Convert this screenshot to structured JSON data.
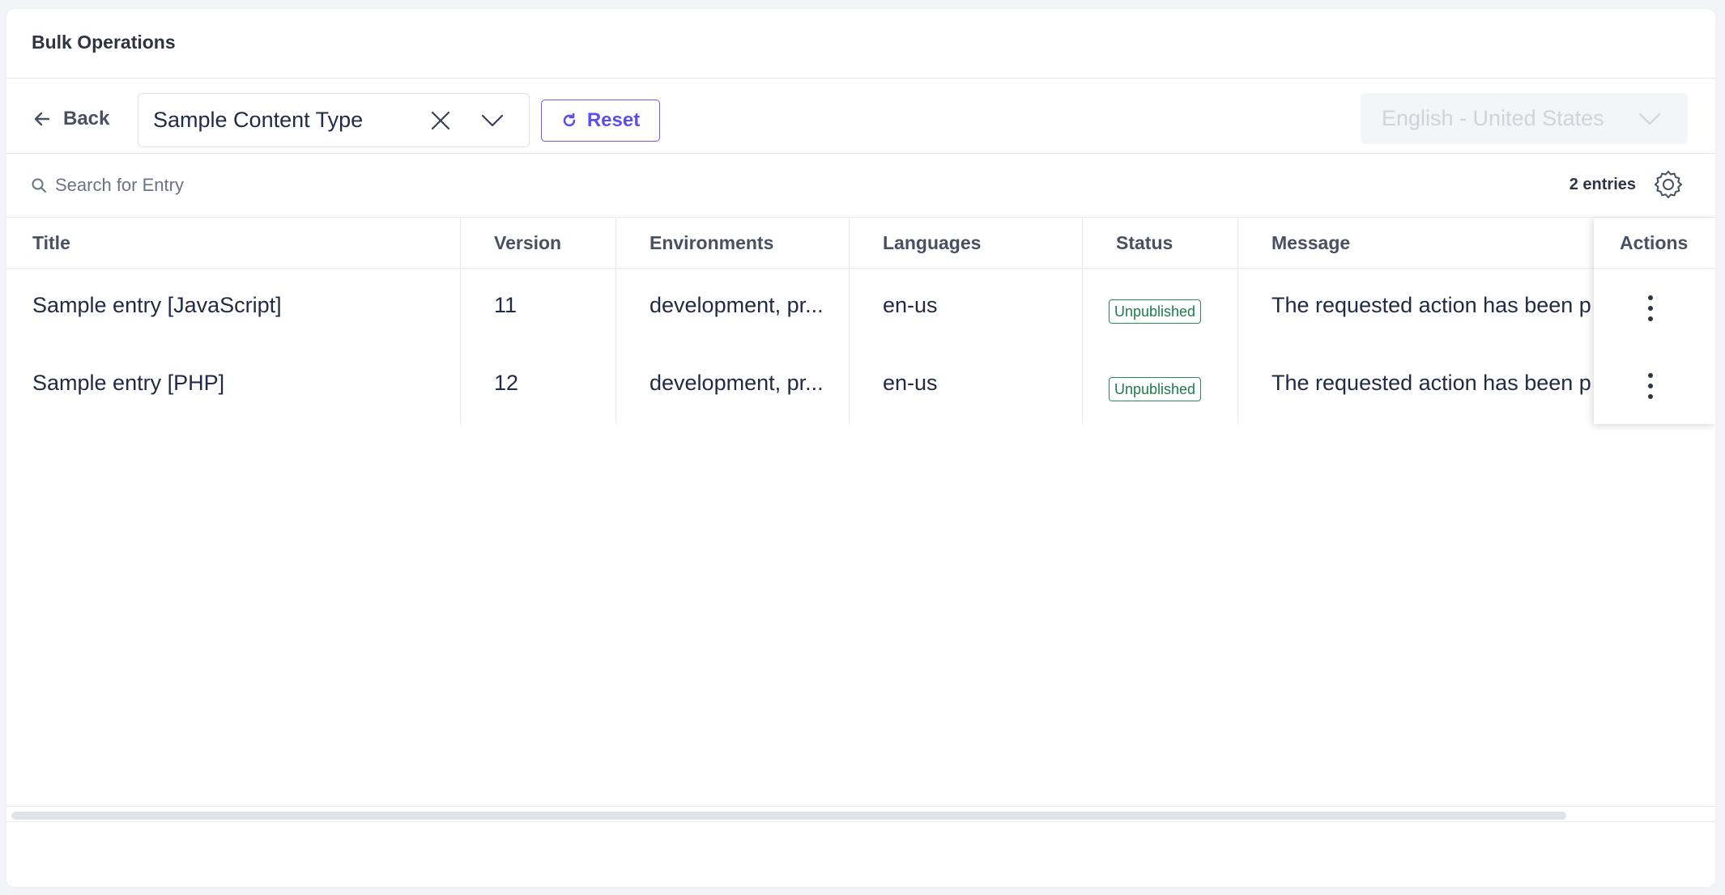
{
  "panel": {
    "title": "Bulk Operations"
  },
  "toolbar": {
    "back_label": "Back",
    "content_type": "Sample Content Type",
    "reset_label": "Reset",
    "locale": "English - United States"
  },
  "search": {
    "placeholder": "Search for Entry",
    "value": ""
  },
  "entries_count": "2 entries",
  "table": {
    "columns": [
      "Title",
      "Version",
      "Environments",
      "Languages",
      "Status",
      "Message",
      "Actions"
    ],
    "rows": [
      {
        "title": "Sample entry [JavaScript]",
        "version": "11",
        "environments": "development, pr...",
        "languages": "en-us",
        "status": "Unpublished",
        "message": "The requested action has been p"
      },
      {
        "title": "Sample entry [PHP]",
        "version": "12",
        "environments": "development, pr...",
        "languages": "en-us",
        "status": "Unpublished",
        "message": "The requested action has been p"
      }
    ]
  },
  "icons": {
    "back": "arrow-left-icon",
    "clear": "close-icon",
    "dropdown": "chevron-down-icon",
    "reset": "refresh-icon",
    "search": "search-icon",
    "settings": "gear-icon",
    "row_actions": "kebab-menu-icon"
  },
  "colors": {
    "accent": "#5d50e6",
    "status_unpublished": "#1f7a4c",
    "muted_text": "#475161"
  }
}
